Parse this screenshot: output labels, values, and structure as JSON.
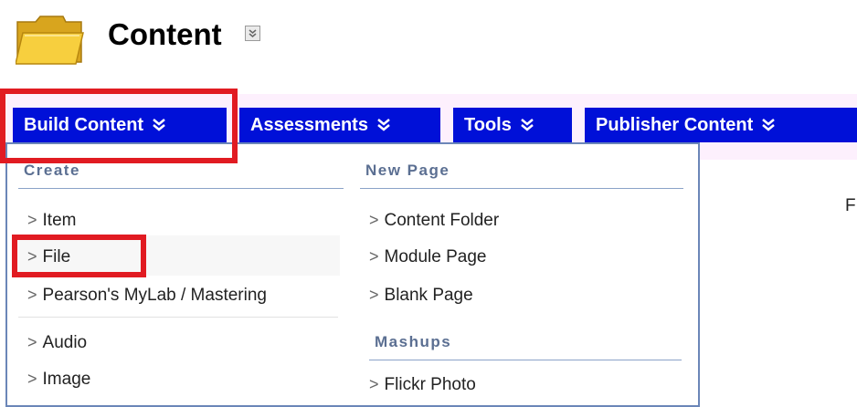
{
  "page": {
    "title": "Content",
    "icons": {
      "folder": "folder-icon",
      "title_menu": "chevron-double-down-icon"
    }
  },
  "action_bar": {
    "tabs": [
      {
        "label": "Build Content",
        "icon": "chevron-double-down-icon"
      },
      {
        "label": "Assessments",
        "icon": "chevron-double-down-icon"
      },
      {
        "label": "Tools",
        "icon": "chevron-double-down-icon"
      },
      {
        "label": "Publisher Content",
        "icon": "chevron-double-down-icon"
      }
    ]
  },
  "dropdown": {
    "columns": [
      {
        "sections": [
          {
            "header": "Create",
            "items": [
              "Item",
              "File",
              "Pearson's MyLab / Mastering",
              "Audio",
              "Image"
            ]
          }
        ]
      },
      {
        "sections": [
          {
            "header": "New Page",
            "items": [
              "Content Folder",
              "Module Page",
              "Blank Page"
            ]
          },
          {
            "header": "Mashups",
            "items": [
              "Flickr Photo"
            ]
          }
        ]
      }
    ],
    "item_arrow": ">"
  },
  "background_text": {
    "partial_letter": "F"
  },
  "colors": {
    "tab_bg": "#0010d8",
    "annotation": "#e11b22",
    "menu_header": "#5b6f92",
    "action_bar_bg": "#fdf0fd"
  }
}
